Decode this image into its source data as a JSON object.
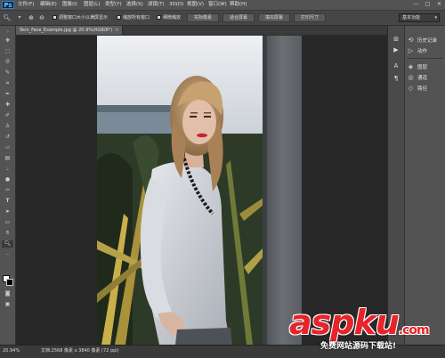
{
  "app": {
    "logo": "Ps"
  },
  "menu": {
    "items": [
      "文件(F)",
      "编辑(E)",
      "图像(I)",
      "图层(L)",
      "类型(Y)",
      "选择(S)",
      "滤镜(T)",
      "3D(D)",
      "视图(V)",
      "窗口(W)",
      "帮助(H)"
    ],
    "window_controls": [
      "—",
      "□",
      "✕"
    ]
  },
  "options": {
    "checkbox1_label": "调整窗口大小以满屏显示",
    "checkbox2_label": "缩放所有窗口",
    "checkbox3_label": "细微缩放",
    "btn_actual": "实际像素",
    "btn_fit": "适合屏幕",
    "btn_fill": "填充屏幕",
    "btn_print": "打印尺寸",
    "workspace": "基本功能"
  },
  "tab": {
    "title": "Skin_Face_Example.jpg @ 20.9%(RGB/8*)",
    "close": "×"
  },
  "panels": {
    "items": [
      {
        "label": "历史记录",
        "icon": "history-icon"
      },
      {
        "label": "动作",
        "icon": "actions-icon"
      },
      {
        "label": "图层",
        "icon": "layers-icon"
      },
      {
        "label": "通道",
        "icon": "channels-icon"
      },
      {
        "label": "路径",
        "icon": "paths-icon"
      }
    ]
  },
  "status": {
    "zoom": "20.94%",
    "doc_info": "文档:2568 像素 x 3840 像素 (72 ppi)",
    "arrow": "▸"
  },
  "watermark": {
    "text": "aspku",
    "dotcom": ".com",
    "sub": "免费网站源码下载站!"
  },
  "colors": {
    "foreground": "#ffffff",
    "background": "#000000",
    "watermark": "#e8232a"
  }
}
